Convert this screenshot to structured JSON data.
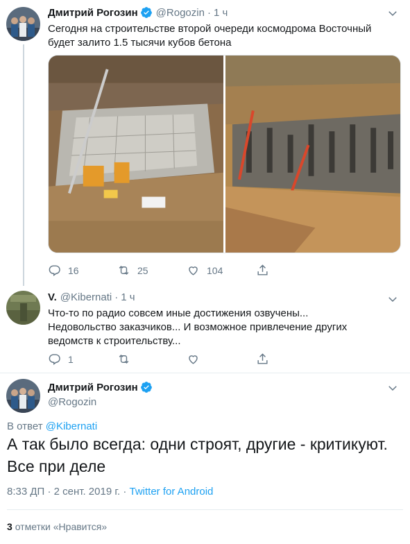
{
  "tweet1": {
    "name": "Дмитрий Рогозин",
    "handle": "@Rogozin",
    "time": "1 ч",
    "text": "Сегодня на строительстве второй очереди космодрома Восточный будет залито 1.5 тысячи кубов бетона",
    "media": [
      {
        "icon": "construction-photo-pit"
      },
      {
        "icon": "construction-photo-cranes"
      }
    ],
    "actions": {
      "reply_count": "16",
      "retweet_count": "25",
      "like_count": "104"
    }
  },
  "tweet2": {
    "name": "V.",
    "handle": "@Kibernati",
    "time": "1 ч",
    "text_lines": [
      "Что-то по радио совсем иные достижения озвучены...",
      "Недовольство заказчиков... И возможное привлечение других",
      "ведомств к строительству..."
    ],
    "actions": {
      "reply_count": "1",
      "retweet_count": "",
      "like_count": ""
    }
  },
  "main_tweet": {
    "name": "Дмитрий Рогозин",
    "handle": "@Rogozin",
    "reply_prefix": "В ответ",
    "reply_to": "@Kibernati",
    "text_lines": [
      "А так было всегда: одни строят, другие - критикуют.",
      "Все при деле"
    ],
    "timestamp": "8:33 ДП · 2 сент. 2019 г.",
    "source_sep": " · ",
    "source": "Twitter for Android",
    "likes_count": "3",
    "likes_label": "отметки «Нравится»"
  },
  "colors": {
    "accent": "#1da1f2",
    "text": "#14171a",
    "secondary": "#657786",
    "divider": "#e6ecf0"
  }
}
